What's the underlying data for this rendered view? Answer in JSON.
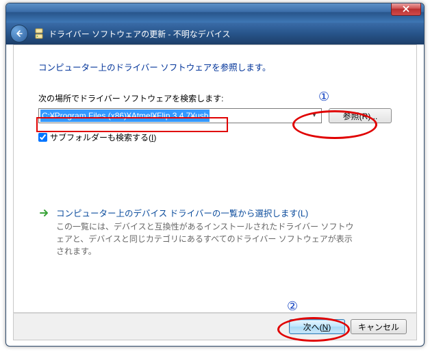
{
  "window": {
    "title": "ドライバー ソフトウェアの更新 - 不明なデバイス"
  },
  "heading": "コンピューター上のドライバー ソフトウェアを参照します。",
  "search_prompt": "次の場所でドライバー ソフトウェアを検索します:",
  "path_value": "C:¥Program Files (x86)¥Atmel¥Flip 3.4.7¥usb",
  "browse_label": "参照(R)...",
  "include_subfolders_label": "サブフォルダーも検索する(I)",
  "driverlist": {
    "title": "コンピューター上のデバイス ドライバーの一覧から選択します(L)",
    "desc": "この一覧には、デバイスと互換性があるインストールされたドライバー ソフトウェアと、デバイスと同じカテゴリにあるすべてのドライバー ソフトウェアが表示されます。"
  },
  "buttons": {
    "next": "次へ(N)",
    "cancel": "キャンセル"
  },
  "annotations": {
    "step1": "①",
    "step2": "②"
  }
}
